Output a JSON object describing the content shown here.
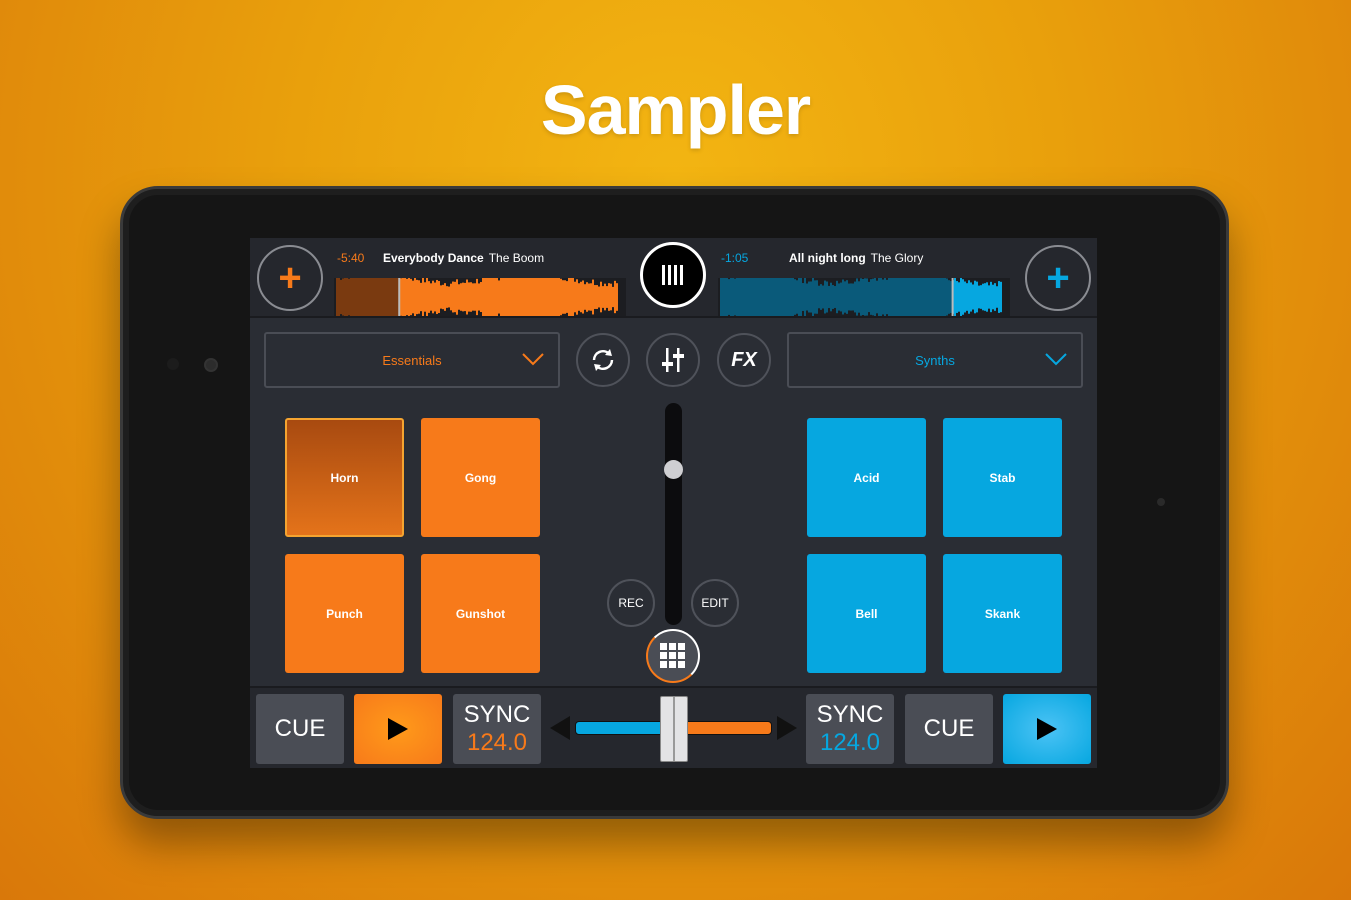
{
  "headline": "Sampler",
  "colors": {
    "deck_a": "#f77a1a",
    "deck_b": "#06a7e0",
    "background": "#2a2d34"
  },
  "deck_a": {
    "time": "-5:40",
    "title": "Everybody Dance",
    "artist": "The Boom",
    "sampler_bank": "Essentials",
    "pads": [
      "Horn",
      "Gong",
      "Punch",
      "Gunshot"
    ],
    "active_pad": "Horn",
    "cue": "CUE",
    "sync": "SYNC",
    "bpm": "124.0",
    "play_icon": "play-icon",
    "add_icon": "plus-icon",
    "progress": 0.22
  },
  "deck_b": {
    "time": "-1:05",
    "title": "All night long",
    "artist": "The Glory",
    "sampler_bank": "Synths",
    "pads": [
      "Acid",
      "Stab",
      "Bell",
      "Skank"
    ],
    "cue": "CUE",
    "sync": "SYNC",
    "bpm": "124.0",
    "play_icon": "play-icon",
    "add_icon": "plus-icon",
    "progress": 0.8
  },
  "center": {
    "fx_label": "FX",
    "rec_label": "REC",
    "edit_label": "EDIT",
    "volume_level": 0.7,
    "crossfader": 0.5
  }
}
